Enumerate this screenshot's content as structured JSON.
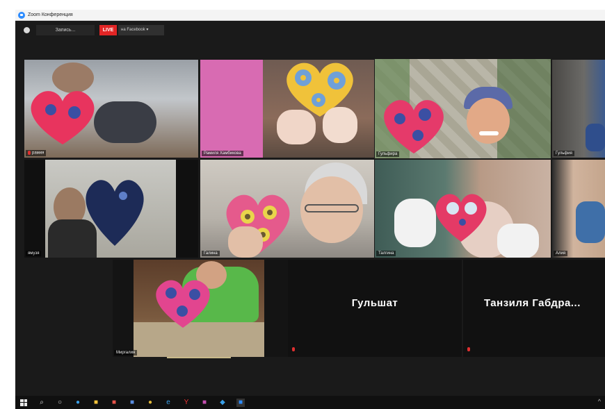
{
  "window": {
    "title": "Zoom Конференция"
  },
  "toolbar": {
    "record_label": "Запись...",
    "live_label": "LIVE",
    "facebook_label": "на Facebook ▾"
  },
  "participants": [
    {
      "name": "рамия"
    },
    {
      "name": "Рамиля Хамбикова"
    },
    {
      "name": "Гульфира"
    },
    {
      "name": "Гульфия"
    },
    {
      "name": "ямузя"
    },
    {
      "name": "Галина"
    },
    {
      "name": "Талгина"
    },
    {
      "name": "Алия"
    },
    {
      "name": "Миргалия"
    }
  ],
  "video_off": [
    {
      "name": "Гульшат"
    },
    {
      "name": "Танзиля  Габдра..."
    }
  ],
  "active_speaker": "Гульфира",
  "colors": {
    "active_border": "#d6d32a",
    "live": "#e22525",
    "background": "#1a1a1a"
  },
  "taskbar": {
    "icons": [
      "windows-start-icon",
      "search-icon",
      "cortana-icon",
      "edge-icon",
      "file-explorer-icon",
      "store-icon",
      "word-icon",
      "chrome-icon",
      "internet-explorer-icon",
      "yandex-icon",
      "photos-icon",
      "mail-icon",
      "zoom-icon"
    ],
    "tray_label": "^"
  }
}
